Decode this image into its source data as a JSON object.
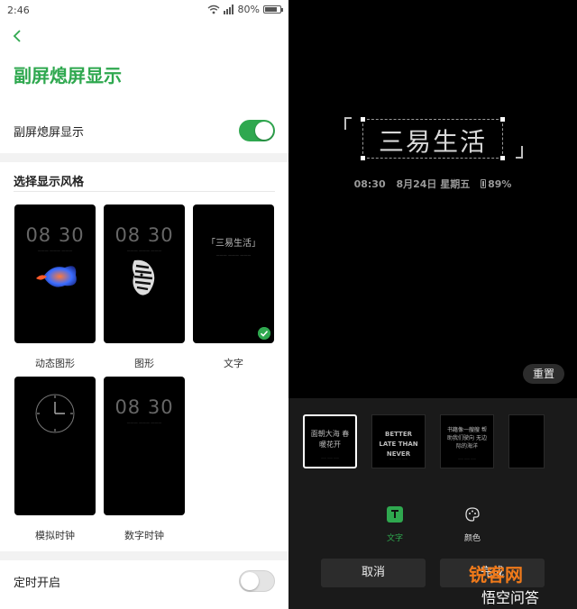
{
  "status_bar": {
    "time": "2:46",
    "battery": "80%",
    "battery_level": 0.8
  },
  "page_title": "副屏熄屏显示",
  "main_toggle": {
    "label": "副屏熄屏显示",
    "on": true
  },
  "styles": {
    "section_title": "选择显示风格",
    "cards": [
      {
        "label": "动态图形",
        "clock": "08 30",
        "selected": false
      },
      {
        "label": "图形",
        "clock": "08 30",
        "selected": false
      },
      {
        "label": "文字",
        "text": "「三易生活」",
        "selected": true
      },
      {
        "label": "模拟时钟",
        "selected": false
      },
      {
        "label": "数字时钟",
        "clock": "08 30",
        "selected": false
      }
    ]
  },
  "schedule_toggle": {
    "label": "定时开启",
    "on": false
  },
  "editor": {
    "preview_text": "三易生活",
    "time": "08:30",
    "date": "8月24日 星期五",
    "battery": "89%",
    "reset_label": "重置",
    "thumbnails": [
      {
        "text": "面朝大海 春暖花开",
        "selected": true
      },
      {
        "text": "BETTER LATE THAN NEVER",
        "selected": false
      },
      {
        "text": "书籍像一艘艘 帮助我们驶向 无边际的海洋",
        "selected": false
      },
      {
        "text": "",
        "selected": false
      }
    ],
    "tabs": [
      {
        "label": "文字",
        "icon": "text-icon",
        "active": true
      },
      {
        "label": "颜色",
        "icon": "palette-icon",
        "active": false
      }
    ],
    "cancel_label": "取消",
    "confirm_label": "完成"
  },
  "watermark": {
    "brand": "锐客网",
    "sub": "悟空问答"
  },
  "colors": {
    "accent": "#2fa84f",
    "panel": "#1a1a1a",
    "button": "#2c2c2c"
  }
}
